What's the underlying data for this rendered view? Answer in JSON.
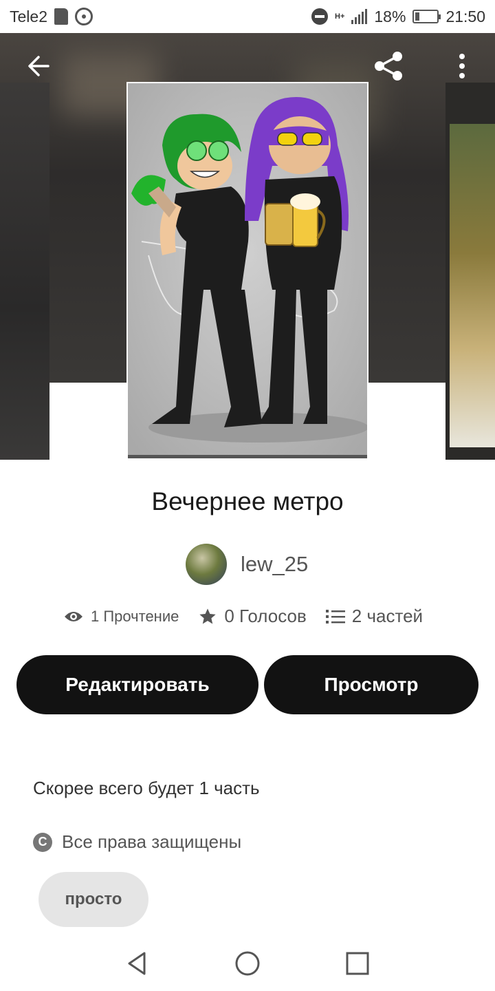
{
  "status_bar": {
    "carrier": "Tele2",
    "network": "H+",
    "battery": "18%",
    "time": "21:50"
  },
  "story": {
    "title": "Вечернее метро",
    "author": "lew_25",
    "reads": "1 Прочтение",
    "votes": "0 Голосов",
    "parts": "2 частей",
    "description": "Скорее всего будет 1 часть",
    "rights": "Все права защищены",
    "tag": "просто"
  },
  "actions": {
    "edit_label": "Редактировать",
    "view_label": "Просмотр"
  },
  "icons": {
    "back": "arrow-left-icon",
    "share": "share-icon",
    "more": "more-vertical-icon",
    "reads": "eye-icon",
    "votes": "star-icon",
    "parts": "list-icon",
    "rights": "copyright-icon"
  },
  "colors": {
    "button": "#121212",
    "tag_bg": "#e5e5e5",
    "text_secondary": "#555555"
  }
}
